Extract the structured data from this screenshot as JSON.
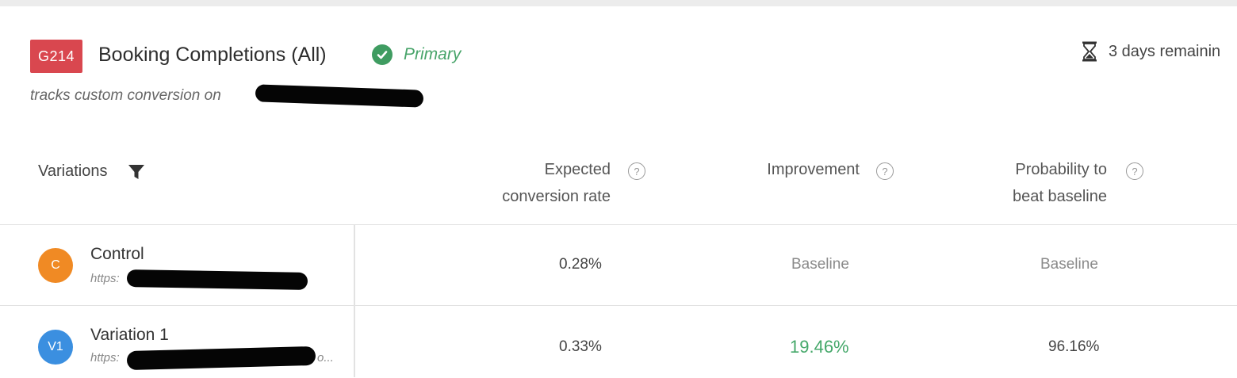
{
  "goal": {
    "badge": "G214",
    "title": "Booking Completions (All)",
    "primary_label": "Primary",
    "remaining": "3 days remainin",
    "description": "tracks custom conversion on"
  },
  "columns": {
    "variations": "Variations",
    "expected_line1": "Expected",
    "expected_line2": "conversion rate",
    "improvement": "Improvement",
    "probability_line1": "Probability to",
    "probability_line2": "beat baseline",
    "help_glyph": "?"
  },
  "rows": [
    {
      "avatar": "C",
      "avatar_color": "#f08a24",
      "name": "Control",
      "url": "https:",
      "expected": "0.28%",
      "improvement": "Baseline",
      "probability": "Baseline"
    },
    {
      "avatar": "V1",
      "avatar_color": "#3b8fe0",
      "name": "Variation 1",
      "url": "https:",
      "url_tail": "o...",
      "expected": "0.33%",
      "improvement": "19.46%",
      "probability": "96.16%"
    }
  ],
  "icons": {
    "primary": "check-circle-icon",
    "remaining": "hourglass-icon",
    "filter": "filter-icon",
    "help": "help-circle-icon"
  },
  "colors": {
    "badge": "#d9474f",
    "primary": "#48a46a",
    "positive": "#45a86a"
  }
}
